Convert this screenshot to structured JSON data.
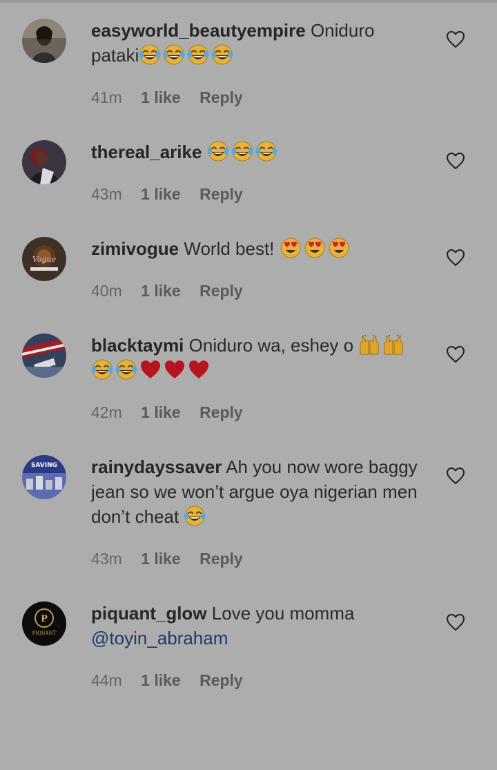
{
  "comments": [
    {
      "username": "easyworld_beautyempire",
      "text_before": "Oniduro pataki",
      "emojis": [
        "laughing",
        "laughing",
        "laughing",
        "laughing"
      ],
      "text_after": "",
      "mention": "",
      "time": "41m",
      "likes": "1 like",
      "reply": "Reply"
    },
    {
      "username": "thereal_arike",
      "text_before": "",
      "emojis": [
        "laughing",
        "laughing",
        "laughing"
      ],
      "text_after": "",
      "mention": "",
      "time": "43m",
      "likes": "1 like",
      "reply": "Reply"
    },
    {
      "username": "zimivogue",
      "text_before": "World best!",
      "emojis": [
        "heart-eyes",
        "heart-eyes",
        "heart-eyes"
      ],
      "text_after": "",
      "mention": "",
      "time": "40m",
      "likes": "1 like",
      "reply": "Reply"
    },
    {
      "username": "blacktaymi",
      "text_before": "Oniduro wa, eshey o",
      "emojis": [
        "raised-hands",
        "raised-hands",
        "laughing",
        "laughing",
        "red-heart",
        "red-heart",
        "red-heart"
      ],
      "text_after": "",
      "mention": "",
      "time": "42m",
      "likes": "1 like",
      "reply": "Reply"
    },
    {
      "username": "rainydayssaver",
      "text_before": "Ah you now wore baggy jean so we won’t argue oya nigerian men don’t cheat",
      "emojis": [
        "laughing"
      ],
      "text_after": "",
      "mention": "",
      "time": "43m",
      "likes": "1 like",
      "reply": "Reply"
    },
    {
      "username": "piquant_glow",
      "text_before": "Love you momma",
      "emojis": [],
      "text_after": "",
      "mention": "@toyin_abraham",
      "time": "44m",
      "likes": "1 like",
      "reply": "Reply"
    }
  ],
  "avatars": {
    "zimivogue_logo_text": "Vogue",
    "rainydayssaver_logo_text": "SAVING",
    "piquant_glow_logo_letter": "P",
    "piquant_glow_logo_text": "PIQUANT"
  },
  "colors": {
    "background": "#adadad",
    "username": "#262626",
    "mention": "#1f3b6a",
    "meta": "#656565",
    "heart_red": "#c8102e"
  },
  "icons": {
    "like": "heart-outline-icon",
    "laughing": "face-with-tears-of-joy-icon",
    "heart-eyes": "smiling-face-with-heart-eyes-icon",
    "raised-hands": "raising-hands-icon",
    "red-heart": "red-heart-icon"
  }
}
